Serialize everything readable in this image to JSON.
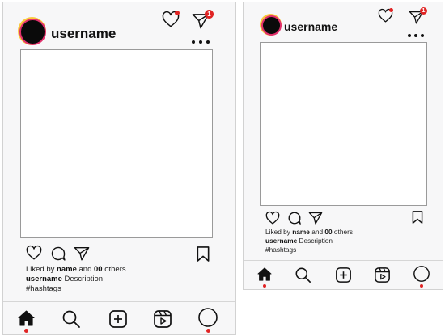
{
  "frames": [
    {
      "username": "username",
      "notification_count": "1",
      "caption": {
        "liked_prefix": "Liked by",
        "liked_name": "name",
        "liked_mid": "and",
        "liked_count": "00",
        "liked_suffix": "others",
        "author": "username",
        "description": "Description",
        "hashtags": "#hashtags"
      },
      "nav": [
        "home-icon",
        "search-icon",
        "create-icon",
        "reels-icon",
        "profile-icon"
      ],
      "active_nav": "home"
    },
    {
      "username": "username",
      "notification_count": "1",
      "caption": {
        "liked_prefix": "Liked by",
        "liked_name": "name",
        "liked_mid": "and",
        "liked_count": "00",
        "liked_suffix": "others",
        "author": "username",
        "description": "Description",
        "hashtags": "#hashtags"
      },
      "nav": [
        "home-icon",
        "search-icon",
        "create-icon",
        "reels-icon",
        "profile-icon"
      ],
      "active_nav": "home"
    }
  ],
  "colors": {
    "accent_red": "#e02424",
    "avatar_ring_gradient": [
      "#f9c93b",
      "#e1306c",
      "#8a3ab9"
    ],
    "frame_bg": "#f7f7f8",
    "photo_bg": "#ffffff",
    "text": "#111111"
  }
}
